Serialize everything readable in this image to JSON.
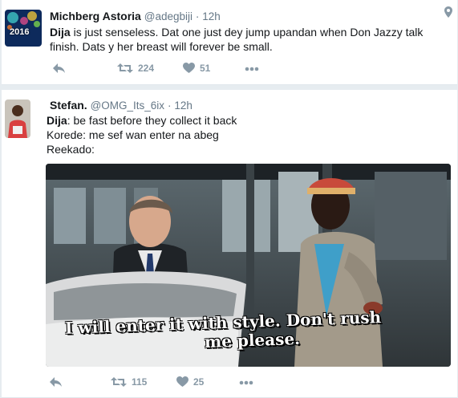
{
  "tweet1": {
    "author_name": "Michberg Astoria",
    "handle": "@adegbiji",
    "separator": "·",
    "time": "12h",
    "avatar_badge": "2016",
    "text_prefix": "Dija",
    "text_rest": " is just senseless. Dat one just dey jump upandan when Don Jazzy talk finish. Dats y her breast will forever be small.",
    "retweets": "224",
    "likes": "51"
  },
  "tweet2": {
    "author_name": "Stefan.",
    "handle": "@OMG_Its_6ix",
    "separator": "·",
    "time": "12h",
    "line1_prefix": "Dija",
    "line1_rest": ": be fast before they collect it back",
    "line2": "Korede: me sef wan enter na abeg",
    "line3": "Reekado:",
    "media_caption_line1": "I will enter it with style. Don't rush",
    "media_caption_line2": "me please.",
    "retweets": "115",
    "likes": "25"
  },
  "colors": {
    "action_gray": "#8899a6",
    "handle_gray": "#657786",
    "text": "#14171a",
    "background": "#e6ecf0"
  },
  "icons": [
    "location-pin-icon",
    "reply-icon",
    "retweet-icon",
    "heart-icon",
    "more-icon"
  ]
}
